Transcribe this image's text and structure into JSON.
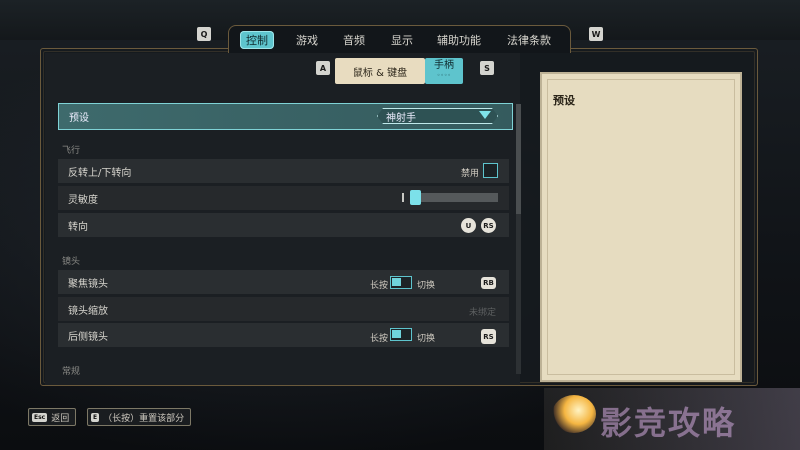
{
  "tabs": {
    "prev_key": "Q",
    "next_key": "W",
    "items": [
      {
        "label": "控制",
        "active": true
      },
      {
        "label": "游戏",
        "active": false
      },
      {
        "label": "音频",
        "active": false
      },
      {
        "label": "显示",
        "active": false
      },
      {
        "label": "辅助功能",
        "active": false
      },
      {
        "label": "法律条款",
        "active": false
      }
    ]
  },
  "subtabs": {
    "prev_key": "A",
    "next_key": "S",
    "keyboard_label": "鼠标 & 键盘",
    "controller_label": "手柄",
    "controller_dots": "◦◦◦◦"
  },
  "preset": {
    "label": "预设",
    "value": "神射手"
  },
  "sections": {
    "flight": "飞行",
    "camera": "镜头",
    "general": "常规"
  },
  "flight_rows": {
    "invert": {
      "label": "反转上/下转向",
      "state": "禁用"
    },
    "sensitivity": {
      "label": "灵敏度",
      "value": 0.06
    },
    "steering": {
      "label": "转向",
      "badge1": "U",
      "badge2": "RS"
    }
  },
  "camera_rows": {
    "focus": {
      "label": "聚焦镜头",
      "hold": "长按",
      "toggle": "切换",
      "binding": "RB"
    },
    "zoom": {
      "label": "镜头缩放",
      "binding": "未绑定"
    },
    "rear": {
      "label": "后侧镜头",
      "hold": "长按",
      "toggle": "切换",
      "binding": "RS"
    }
  },
  "description": {
    "title": "预设"
  },
  "bottom": {
    "back_key": "Esc",
    "back_label": "返回",
    "reset_key": "E",
    "reset_label": "（长按）重置该部分"
  },
  "watermark": {
    "text": "影竞攻略"
  }
}
